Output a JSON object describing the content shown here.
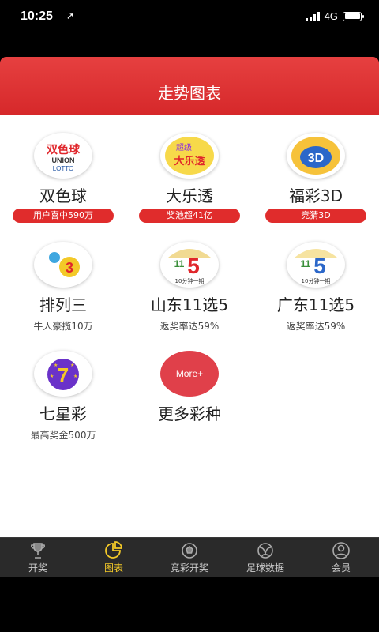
{
  "status": {
    "time": "10:25",
    "network": "4G"
  },
  "header": {
    "title": "走势图表"
  },
  "lotteries": [
    {
      "name": "双色球",
      "badge": "用户喜中590万",
      "logo_text": "双色球",
      "logo_sub": "UNION",
      "logo_sub2": "LOTTO"
    },
    {
      "name": "大乐透",
      "badge": "奖池超41亿",
      "logo_text": "大乐透",
      "logo_sub": "超级"
    },
    {
      "name": "福彩3D",
      "badge": "竞猜3D",
      "logo_text": "3D"
    },
    {
      "name": "排列三",
      "sub": "牛人豪揽10万",
      "logo_text": "3"
    },
    {
      "name": "山东11选5",
      "sub": "返奖率达59%",
      "logo_text": "5",
      "logo_sub": "11",
      "logo_sub2": "10分钟一期"
    },
    {
      "name": "广东11选5",
      "sub": "返奖率达59%",
      "logo_text": "5",
      "logo_sub": "11",
      "logo_sub2": "10分钟一期"
    },
    {
      "name": "七星彩",
      "sub": "最高奖金500万",
      "logo_text": "7"
    },
    {
      "name": "更多彩种",
      "logo_text": "More+"
    }
  ],
  "tabs": [
    {
      "label": "开奖",
      "icon": "trophy-icon"
    },
    {
      "label": "图表",
      "icon": "pie-chart-icon"
    },
    {
      "label": "竞彩开奖",
      "icon": "soccer-ball-icon"
    },
    {
      "label": "足球数据",
      "icon": "football-data-icon"
    },
    {
      "label": "会员",
      "icon": "user-icon"
    }
  ],
  "colors": {
    "accent": "#d6282a",
    "tab_active": "#f3c928"
  }
}
